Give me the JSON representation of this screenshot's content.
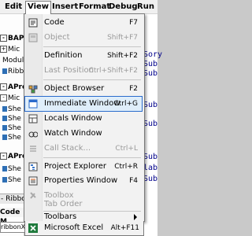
{
  "menubar": {
    "items": [
      "Edit",
      "View",
      "Insert",
      "Format",
      "Debug",
      "Run"
    ],
    "active_index": 1
  },
  "view_menu": {
    "items": [
      {
        "label": "Code",
        "shortcut": "F7",
        "icon": "code-icon",
        "enabled": true
      },
      {
        "label": "Object",
        "shortcut": "Shift+F7",
        "icon": "object-icon",
        "enabled": false
      },
      {
        "label": "Definition",
        "shortcut": "Shift+F2",
        "icon": "",
        "enabled": true
      },
      {
        "label": "Last Position",
        "shortcut": "Ctrl+Shift+F2",
        "icon": "",
        "enabled": false
      },
      {
        "label": "Object Browser",
        "shortcut": "F2",
        "icon": "object-browser-icon",
        "enabled": true
      },
      {
        "label": "Immediate Window",
        "shortcut": "Ctrl+G",
        "icon": "immediate-window-icon",
        "enabled": true,
        "highlighted": true
      },
      {
        "label": "Locals Window",
        "shortcut": "",
        "icon": "locals-window-icon",
        "enabled": true
      },
      {
        "label": "Watch Window",
        "shortcut": "",
        "icon": "watch-window-icon",
        "enabled": true
      },
      {
        "label": "Call Stack...",
        "shortcut": "Ctrl+L",
        "icon": "call-stack-icon",
        "enabled": false
      },
      {
        "label": "Project Explorer",
        "shortcut": "Ctrl+R",
        "icon": "project-explorer-icon",
        "enabled": true
      },
      {
        "label": "Properties Window",
        "shortcut": "F4",
        "icon": "properties-window-icon",
        "enabled": true
      },
      {
        "label": "Toolbox",
        "shortcut": "",
        "icon": "toolbox-icon",
        "enabled": false
      },
      {
        "label": "Tab Order",
        "shortcut": "",
        "icon": "",
        "enabled": false
      },
      {
        "label": "Toolbars",
        "shortcut": "",
        "icon": "",
        "enabled": true,
        "submenu": true
      },
      {
        "label": "Microsoft Excel",
        "shortcut": "Alt+F11",
        "icon": "excel-icon",
        "enabled": true
      }
    ]
  },
  "left_pane": {
    "rows": [
      "BAProje",
      "Mic",
      "Module",
      "Ribb",
      "AProje",
      "Mic",
      "She",
      "She",
      "She",
      "She",
      "APro",
      "She",
      "She"
    ],
    "ribbon_label": "- Ribbo",
    "props_tabs": "Code M",
    "props_name": "ribbonX_C"
  },
  "right_pane": {
    "lines": [
      "Sory",
      "Sub",
      "Sub",
      "",
      "",
      "Sub",
      "Sub",
      "",
      "Sub",
      "lab",
      "Sub",
      "",
      ""
    ]
  },
  "colors": {
    "highlight_border": "#2a6bcc",
    "highlight_fill": "#dfeefa",
    "menu_bg": "#f2f2f2"
  }
}
